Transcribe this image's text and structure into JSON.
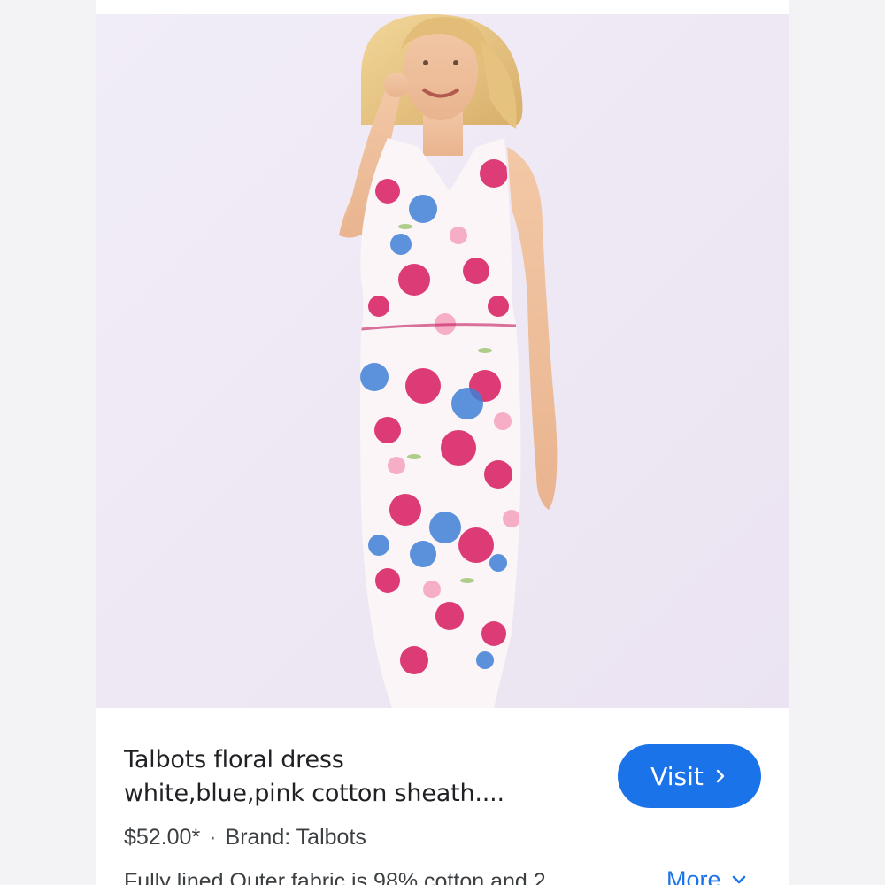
{
  "product": {
    "title_line1": "Talbots floral dress",
    "title_line2": "white,blue,pink cotton sheath....",
    "price": "$52.00*",
    "separator": "·",
    "brand": "Brand: Talbots",
    "description": "Fully lined.Outer fabric is 98% cotton and 2 ...",
    "visit_label": "Visit",
    "more_label": "More"
  },
  "colors": {
    "accent": "#1a73e8",
    "title_text": "#202124",
    "body_text": "#3c4043",
    "image_background": "#efe9f5",
    "dress_pink": "#d81b60",
    "dress_blue": "#3f7fd6"
  },
  "icons": {
    "visit": "chevron-right-icon",
    "more": "chevron-down-icon"
  }
}
